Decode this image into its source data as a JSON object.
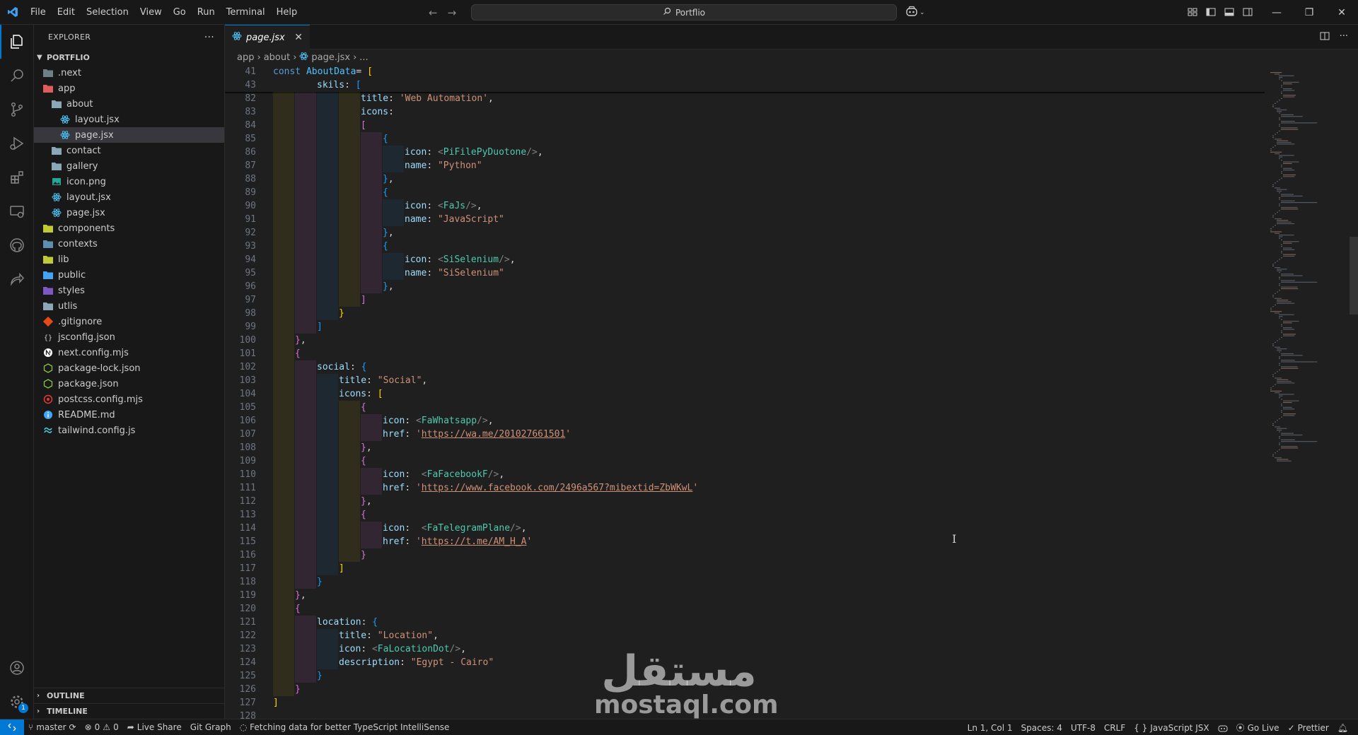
{
  "titlebar": {
    "menu": [
      "File",
      "Edit",
      "Selection",
      "View",
      "Go",
      "Run",
      "Terminal",
      "Help"
    ],
    "search_text": "Portflio"
  },
  "sidebar": {
    "title": "EXPLORER",
    "more": "···",
    "root": "PORTFLIO",
    "tree": [
      {
        "label": ".next",
        "depth": 0,
        "icon": "folder-next-icon",
        "color": "#6d8086"
      },
      {
        "label": "app",
        "depth": 0,
        "icon": "folder-app-open-icon",
        "color": "#e05d5d"
      },
      {
        "label": "about",
        "depth": 1,
        "icon": "folder-open-icon",
        "color": "#8aa8b8"
      },
      {
        "label": "layout.jsx",
        "depth": 2,
        "icon": "react-icon",
        "color": "#4fc3f7"
      },
      {
        "label": "page.jsx",
        "depth": 2,
        "icon": "react-icon",
        "color": "#4fc3f7",
        "selected": true
      },
      {
        "label": "contact",
        "depth": 1,
        "icon": "folder-icon",
        "color": "#8aa8b8"
      },
      {
        "label": "gallery",
        "depth": 1,
        "icon": "folder-icon",
        "color": "#8aa8b8"
      },
      {
        "label": "icon.png",
        "depth": 1,
        "icon": "image-icon",
        "color": "#26a69a"
      },
      {
        "label": "layout.jsx",
        "depth": 1,
        "icon": "react-icon",
        "color": "#4fc3f7"
      },
      {
        "label": "page.jsx",
        "depth": 1,
        "icon": "react-icon",
        "color": "#4fc3f7"
      },
      {
        "label": "components",
        "depth": 0,
        "icon": "folder-components-icon",
        "color": "#c0ca33"
      },
      {
        "label": "contexts",
        "depth": 0,
        "icon": "folder-contexts-icon",
        "color": "#5c8fb0"
      },
      {
        "label": "lib",
        "depth": 0,
        "icon": "folder-lib-icon",
        "color": "#c0ca33"
      },
      {
        "label": "public",
        "depth": 0,
        "icon": "folder-public-icon",
        "color": "#42a5f5"
      },
      {
        "label": "styles",
        "depth": 0,
        "icon": "folder-styles-icon",
        "color": "#7e57c2"
      },
      {
        "label": "utlis",
        "depth": 0,
        "icon": "folder-icon",
        "color": "#8aa8b8"
      },
      {
        "label": ".gitignore",
        "depth": 0,
        "icon": "git-icon",
        "color": "#e64a19"
      },
      {
        "label": "jsconfig.json",
        "depth": 0,
        "icon": "jsconfig-icon",
        "color": "#cccccc"
      },
      {
        "label": "next.config.mjs",
        "depth": 0,
        "icon": "nextjs-icon",
        "color": "#ffffff"
      },
      {
        "label": "package-lock.json",
        "depth": 0,
        "icon": "nodejs-icon",
        "color": "#8bc34a"
      },
      {
        "label": "package.json",
        "depth": 0,
        "icon": "nodejs-icon",
        "color": "#8bc34a"
      },
      {
        "label": "postcss.config.mjs",
        "depth": 0,
        "icon": "postcss-icon",
        "color": "#e53935"
      },
      {
        "label": "README.md",
        "depth": 0,
        "icon": "info-icon",
        "color": "#42a5f5"
      },
      {
        "label": "tailwind.config.js",
        "depth": 0,
        "icon": "tailwind-icon",
        "color": "#4dd0e1"
      }
    ],
    "outline": "OUTLINE",
    "timeline": "TIMELINE"
  },
  "editor": {
    "tab_label": "page.jsx",
    "breadcrumb": [
      "app",
      "about",
      "page.jsx",
      "..."
    ]
  },
  "code_lines": [
    {
      "n": "41",
      "d": 0,
      "t": [
        [
          "tk-kw",
          "const "
        ],
        [
          "tk-var",
          "AboutData"
        ],
        [
          "",
          "= "
        ],
        [
          "b1",
          "["
        ]
      ]
    },
    {
      "n": "43",
      "d": 2,
      "t": [
        [
          "tk-prop",
          "skils"
        ],
        [
          "",
          ": "
        ],
        [
          "b3",
          "["
        ]
      ]
    },
    {
      "n": "82",
      "d": 4,
      "t": [
        [
          "tk-prop",
          "title"
        ],
        [
          "",
          ": "
        ],
        [
          "tk-str",
          "'Web Automation'"
        ],
        [
          "",
          ","
        ]
      ]
    },
    {
      "n": "83",
      "d": 4,
      "t": [
        [
          "tk-prop",
          "icons"
        ],
        [
          "",
          ":"
        ]
      ]
    },
    {
      "n": "84",
      "d": 4,
      "t": [
        [
          "b2",
          "["
        ]
      ]
    },
    {
      "n": "85",
      "d": 5,
      "t": [
        [
          "b3",
          "{"
        ]
      ]
    },
    {
      "n": "86",
      "d": 6,
      "t": [
        [
          "tk-prop",
          "icon"
        ],
        [
          "",
          ": "
        ],
        [
          "tk-punc",
          "<"
        ],
        [
          "tk-tag",
          "PiFilePyDuotone"
        ],
        [
          "tk-punc",
          "/>"
        ],
        [
          "",
          ","
        ]
      ]
    },
    {
      "n": "87",
      "d": 6,
      "t": [
        [
          "tk-prop",
          "name"
        ],
        [
          "",
          ": "
        ],
        [
          "tk-str",
          "\"Python\""
        ]
      ]
    },
    {
      "n": "88",
      "d": 5,
      "t": [
        [
          "b3",
          "}"
        ],
        [
          "",
          ","
        ]
      ]
    },
    {
      "n": "89",
      "d": 5,
      "t": [
        [
          "b3",
          "{"
        ]
      ]
    },
    {
      "n": "90",
      "d": 6,
      "t": [
        [
          "tk-prop",
          "icon"
        ],
        [
          "",
          ": "
        ],
        [
          "tk-punc",
          "<"
        ],
        [
          "tk-tag",
          "FaJs"
        ],
        [
          "tk-punc",
          "/>"
        ],
        [
          "",
          ","
        ]
      ]
    },
    {
      "n": "91",
      "d": 6,
      "t": [
        [
          "tk-prop",
          "name"
        ],
        [
          "",
          ": "
        ],
        [
          "tk-str",
          "\"JavaScript\""
        ]
      ]
    },
    {
      "n": "92",
      "d": 5,
      "t": [
        [
          "b3",
          "}"
        ],
        [
          "",
          ","
        ]
      ]
    },
    {
      "n": "93",
      "d": 5,
      "t": [
        [
          "b3",
          "{"
        ]
      ]
    },
    {
      "n": "94",
      "d": 6,
      "t": [
        [
          "tk-prop",
          "icon"
        ],
        [
          "",
          ": "
        ],
        [
          "tk-punc",
          "<"
        ],
        [
          "tk-tag",
          "SiSelenium"
        ],
        [
          "tk-punc",
          "/>"
        ],
        [
          "",
          ","
        ]
      ]
    },
    {
      "n": "95",
      "d": 6,
      "t": [
        [
          "tk-prop",
          "name"
        ],
        [
          "",
          ": "
        ],
        [
          "tk-str",
          "\"SiSelenium\""
        ]
      ]
    },
    {
      "n": "96",
      "d": 5,
      "t": [
        [
          "b3",
          "}"
        ],
        [
          "",
          ","
        ]
      ]
    },
    {
      "n": "97",
      "d": 4,
      "t": [
        [
          "b2",
          "]"
        ]
      ]
    },
    {
      "n": "98",
      "d": 3,
      "t": [
        [
          "b1",
          "}"
        ]
      ]
    },
    {
      "n": "99",
      "d": 2,
      "t": [
        [
          "b3",
          "]"
        ]
      ]
    },
    {
      "n": "100",
      "d": 1,
      "t": [
        [
          "b2",
          "}"
        ],
        [
          "",
          ","
        ]
      ]
    },
    {
      "n": "101",
      "d": 1,
      "t": [
        [
          "b2",
          "{"
        ]
      ]
    },
    {
      "n": "102",
      "d": 2,
      "t": [
        [
          "tk-prop",
          "social"
        ],
        [
          "",
          ": "
        ],
        [
          "b3",
          "{"
        ]
      ]
    },
    {
      "n": "103",
      "d": 3,
      "t": [
        [
          "tk-prop",
          "title"
        ],
        [
          "",
          ": "
        ],
        [
          "tk-str",
          "\"Social\""
        ],
        [
          "",
          ","
        ]
      ]
    },
    {
      "n": "104",
      "d": 3,
      "t": [
        [
          "tk-prop",
          "icons"
        ],
        [
          "",
          ": "
        ],
        [
          "b1",
          "["
        ]
      ]
    },
    {
      "n": "105",
      "d": 4,
      "t": [
        [
          "b2",
          "{"
        ]
      ]
    },
    {
      "n": "106",
      "d": 5,
      "t": [
        [
          "tk-prop",
          "icon"
        ],
        [
          "",
          ": "
        ],
        [
          "tk-punc",
          "<"
        ],
        [
          "tk-tag",
          "FaWhatsapp"
        ],
        [
          "tk-punc",
          "/>"
        ],
        [
          "",
          ","
        ]
      ]
    },
    {
      "n": "107",
      "d": 5,
      "t": [
        [
          "tk-prop",
          "href"
        ],
        [
          "",
          ": "
        ],
        [
          "tk-str",
          "'"
        ],
        [
          "tk-url",
          "https://wa.me/201027661501"
        ],
        [
          "tk-str",
          "'"
        ]
      ]
    },
    {
      "n": "108",
      "d": 4,
      "t": [
        [
          "b2",
          "}"
        ],
        [
          "",
          ","
        ]
      ]
    },
    {
      "n": "109",
      "d": 4,
      "t": [
        [
          "b2",
          "{"
        ]
      ]
    },
    {
      "n": "110",
      "d": 5,
      "t": [
        [
          "tk-prop",
          "icon"
        ],
        [
          "",
          ":  "
        ],
        [
          "tk-punc",
          "<"
        ],
        [
          "tk-tag",
          "FaFacebookF"
        ],
        [
          "tk-punc",
          "/>"
        ],
        [
          "",
          ","
        ]
      ]
    },
    {
      "n": "111",
      "d": 5,
      "t": [
        [
          "tk-prop",
          "href"
        ],
        [
          "",
          ": "
        ],
        [
          "tk-str",
          "'"
        ],
        [
          "tk-url",
          "https://www.facebook.com/2496a567?mibextid=ZbWKwL"
        ],
        [
          "tk-str",
          "'"
        ]
      ]
    },
    {
      "n": "112",
      "d": 4,
      "t": [
        [
          "b2",
          "}"
        ],
        [
          "",
          ","
        ]
      ]
    },
    {
      "n": "113",
      "d": 4,
      "t": [
        [
          "b2",
          "{"
        ]
      ]
    },
    {
      "n": "114",
      "d": 5,
      "t": [
        [
          "tk-prop",
          "icon"
        ],
        [
          "",
          ":  "
        ],
        [
          "tk-punc",
          "<"
        ],
        [
          "tk-tag",
          "FaTelegramPlane"
        ],
        [
          "tk-punc",
          "/>"
        ],
        [
          "",
          ","
        ]
      ]
    },
    {
      "n": "115",
      "d": 5,
      "t": [
        [
          "tk-prop",
          "href"
        ],
        [
          "",
          ": "
        ],
        [
          "tk-str",
          "'"
        ],
        [
          "tk-url",
          "https://t.me/AM_H_A"
        ],
        [
          "tk-str",
          "'"
        ]
      ]
    },
    {
      "n": "116",
      "d": 4,
      "t": [
        [
          "b2",
          "}"
        ]
      ]
    },
    {
      "n": "117",
      "d": 3,
      "t": [
        [
          "b1",
          "]"
        ]
      ]
    },
    {
      "n": "118",
      "d": 2,
      "t": [
        [
          "b3",
          "}"
        ]
      ]
    },
    {
      "n": "119",
      "d": 1,
      "t": [
        [
          "b2",
          "}"
        ],
        [
          "",
          ","
        ]
      ]
    },
    {
      "n": "120",
      "d": 1,
      "t": [
        [
          "b2",
          "{"
        ]
      ]
    },
    {
      "n": "121",
      "d": 2,
      "t": [
        [
          "tk-prop",
          "location"
        ],
        [
          "",
          ": "
        ],
        [
          "b3",
          "{"
        ]
      ]
    },
    {
      "n": "122",
      "d": 3,
      "t": [
        [
          "tk-prop",
          "title"
        ],
        [
          "",
          ": "
        ],
        [
          "tk-str",
          "\"Location\""
        ],
        [
          "",
          ","
        ]
      ]
    },
    {
      "n": "123",
      "d": 3,
      "t": [
        [
          "tk-prop",
          "icon"
        ],
        [
          "",
          ": "
        ],
        [
          "tk-punc",
          "<"
        ],
        [
          "tk-tag",
          "FaLocationDot"
        ],
        [
          "tk-punc",
          "/>"
        ],
        [
          "",
          ","
        ]
      ]
    },
    {
      "n": "124",
      "d": 3,
      "t": [
        [
          "tk-prop",
          "description"
        ],
        [
          "",
          ": "
        ],
        [
          "tk-str",
          "\"Egypt - Cairo\""
        ]
      ]
    },
    {
      "n": "125",
      "d": 2,
      "t": [
        [
          "b3",
          "}"
        ]
      ]
    },
    {
      "n": "126",
      "d": 1,
      "t": [
        [
          "b2",
          "}"
        ]
      ]
    },
    {
      "n": "127",
      "d": 0,
      "t": [
        [
          "b1",
          "]"
        ]
      ]
    },
    {
      "n": "128",
      "d": 0,
      "t": []
    }
  ],
  "watermark": {
    "arabic": "مستقل",
    "latin": "mostaql.com"
  },
  "statusbar": {
    "branch": "master",
    "problems": "0",
    "warnings": "0",
    "live_share": "Live Share",
    "git_graph": "Git Graph",
    "message": "Fetching data for better TypeScript IntelliSense",
    "position": "Ln 1, Col 1",
    "spaces": "Spaces: 4",
    "encoding": "UTF-8",
    "eol": "CRLF",
    "language": "JavaScript JSX",
    "go_live": "Go Live",
    "prettier": "Prettier"
  },
  "colors": {
    "accent": "#0078d4",
    "background": "#1f1f1f",
    "sidebar": "#181818"
  }
}
